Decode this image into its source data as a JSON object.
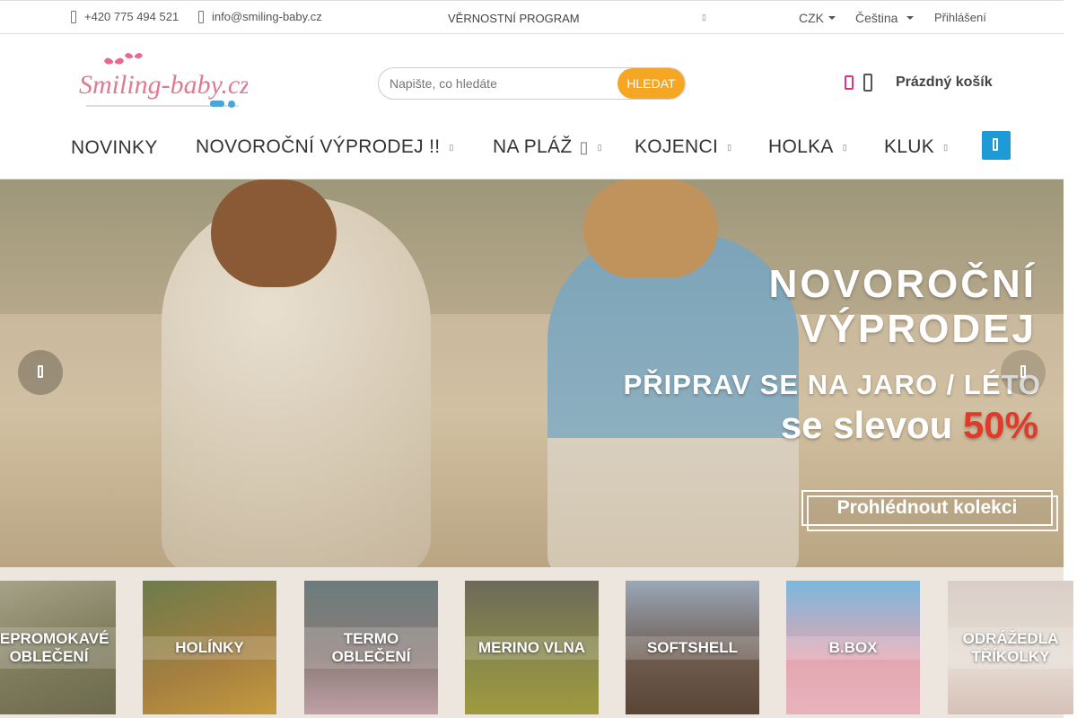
{
  "topbar": {
    "phone": "+420 775 494 521",
    "email": "info@smiling-baby.cz",
    "loyalty": "VĚRNOSTNÍ PROGRAM",
    "currency": "CZK",
    "language": "Čeština",
    "login": "Přihlášení"
  },
  "header": {
    "logo_text": "Smiling-baby.cz",
    "search_placeholder": "Napište, co hledáte",
    "search_button": "HLEDAT",
    "cart_label": "Prázdný košík"
  },
  "nav": {
    "items": [
      {
        "label": "NOVINKY"
      },
      {
        "label": "NOVOROČNÍ VÝPRODEJ !!"
      },
      {
        "label": "NA PLÁŽ"
      },
      {
        "label": "KOJENCI"
      },
      {
        "label": "HOLKA"
      },
      {
        "label": "KLUK"
      }
    ]
  },
  "hero": {
    "line1": "NOVOROČNÍ",
    "line2": "VÝPRODEJ",
    "line3": "PŘIPRAV SE NA JARO / LÉTO",
    "sale_text": "se slevou",
    "sale_percent": "50%",
    "cta": "Prohlédnout kolekci"
  },
  "categories": [
    {
      "label_line1": "NEPROMOKAVÉ",
      "label_line2": "OBLEČENÍ"
    },
    {
      "label_line1": "HOLÍNKY",
      "label_line2": ""
    },
    {
      "label_line1": "TERMO",
      "label_line2": "OBLEČENÍ"
    },
    {
      "label_line1": "MERINO VLNA",
      "label_line2": ""
    },
    {
      "label_line1": "SOFTSHELL",
      "label_line2": ""
    },
    {
      "label_line1": "B.BOX",
      "label_line2": ""
    },
    {
      "label_line1": "ODRÁŽEDLA",
      "label_line2": "TŘÍKOLKY"
    }
  ],
  "colors": {
    "accent": "#f5a623",
    "menu_button": "#1e9ad6",
    "heart": "#e0337a",
    "sale_red": "#e03a2b"
  }
}
